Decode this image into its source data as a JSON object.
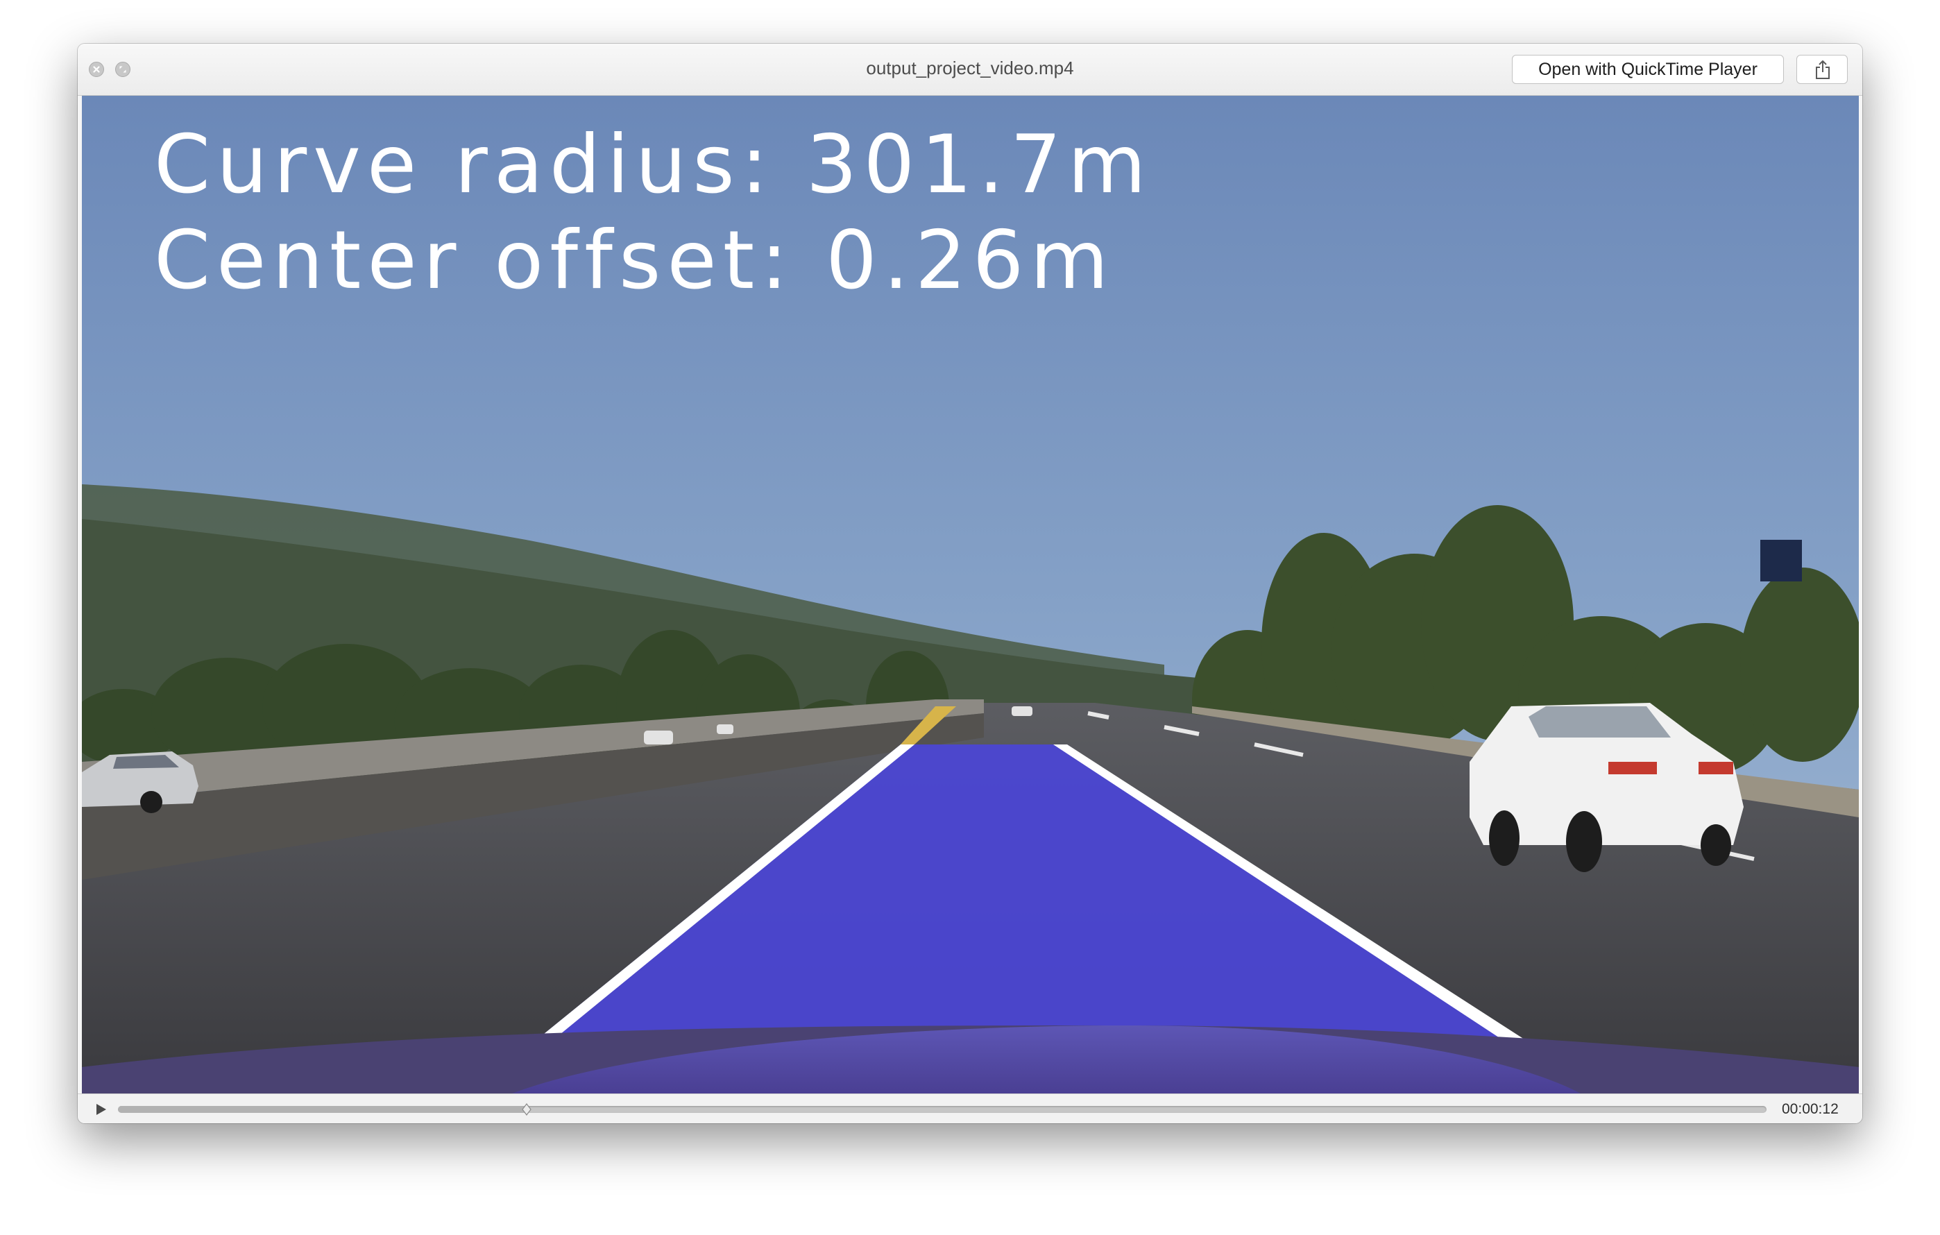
{
  "window": {
    "title": "output_project_video.mp4",
    "open_with_label": "Open with QuickTime Player",
    "close_icon": "close-icon",
    "fullscreen_icon": "fullscreen-icon",
    "share_icon": "share-icon"
  },
  "video": {
    "overlay": {
      "curve_radius": "Curve radius: 301.7m",
      "center_offset": "Center offset: 0.26m"
    },
    "lane_overlay_color": "#4b45d6"
  },
  "controls": {
    "play_icon": "play-icon",
    "timecode": "00:00:12",
    "progress_fraction": 0.248
  },
  "colors": {
    "window_bg": "#f6f6f6",
    "text": "#4c4c4c"
  }
}
